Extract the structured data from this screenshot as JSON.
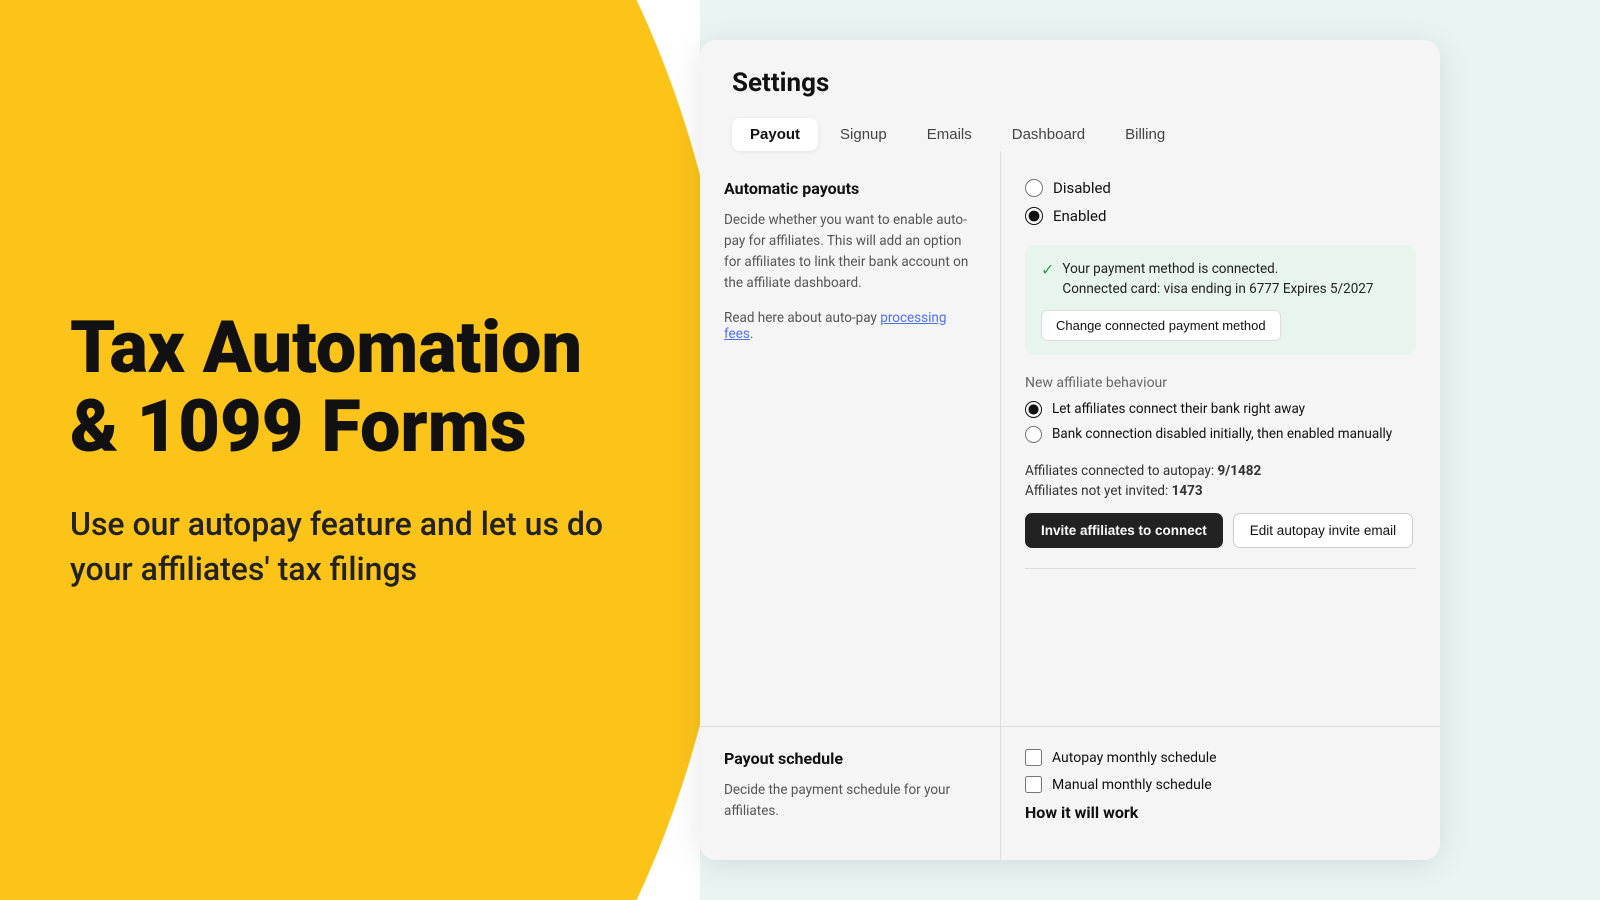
{
  "left": {
    "heading_line1": "Tax Automation",
    "heading_line2": "& 1099 Forms",
    "subtext": "Use our autopay feature and let us do your affiliates' tax filings"
  },
  "settings": {
    "title": "Settings",
    "tabs": [
      {
        "id": "payout",
        "label": "Payout",
        "active": true
      },
      {
        "id": "signup",
        "label": "Signup",
        "active": false
      },
      {
        "id": "emails",
        "label": "Emails",
        "active": false
      },
      {
        "id": "dashboard",
        "label": "Dashboard",
        "active": false
      },
      {
        "id": "billing",
        "label": "Billing",
        "active": false
      }
    ],
    "automatic_payouts": {
      "title": "Automatic payouts",
      "description": "Decide whether you want to enable auto-pay for affiliates. This will add an option for affiliates to link their bank account on the affiliate dashboard.",
      "read_more_prefix": "Read here about auto-pay ",
      "processing_fees_label": "processing fees",
      "processing_fees_link": "#"
    },
    "payout_options": [
      {
        "id": "disabled",
        "label": "Disabled",
        "checked": false
      },
      {
        "id": "enabled",
        "label": "Enabled",
        "checked": true
      }
    ],
    "payment_banner": {
      "message_line1": "Your payment method is connected.",
      "message_line2": "Connected card: visa ending in 6777 Expires 5/2027",
      "change_button": "Change connected payment method"
    },
    "new_affiliate_behaviour": {
      "title": "New affiliate behaviour",
      "options": [
        {
          "id": "connect-right-away",
          "label": "Let affiliates connect their bank right away",
          "checked": true
        },
        {
          "id": "disabled-initially",
          "label": "Bank connection disabled initially, then enabled manually",
          "checked": false
        }
      ]
    },
    "stats": {
      "connected_label": "Affiliates connected to autopay:",
      "connected_value": "9/1482",
      "not_invited_label": "Affiliates not yet invited:",
      "not_invited_value": "1473"
    },
    "buttons": {
      "invite": "Invite affiliates to connect",
      "edit_email": "Edit autopay invite email"
    },
    "payout_schedule": {
      "title": "Payout schedule",
      "description": "Decide the payment schedule for your affiliates.",
      "options": [
        {
          "id": "autopay-monthly",
          "label": "Autopay monthly schedule",
          "checked": false
        },
        {
          "id": "manual-monthly",
          "label": "Manual monthly schedule",
          "checked": false
        }
      ],
      "how_it_works_title": "How it will work"
    }
  }
}
